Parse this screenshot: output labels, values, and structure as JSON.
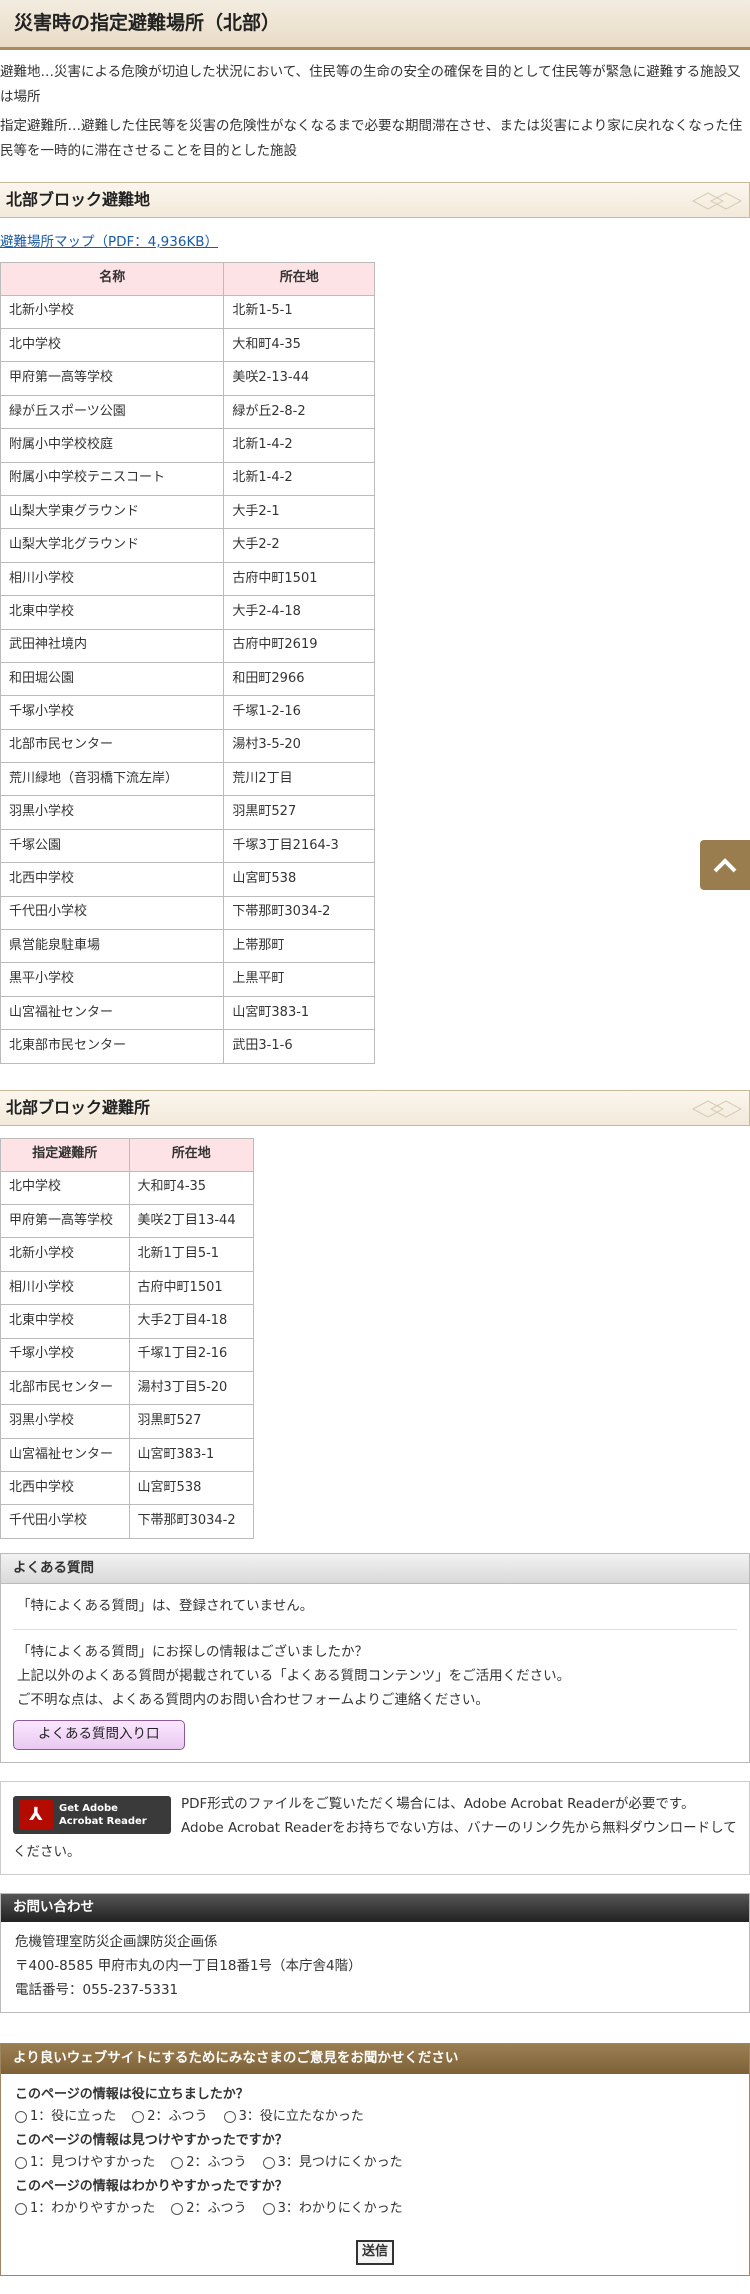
{
  "page": {
    "title": "災害時の指定避難場所（北部）",
    "definitions": [
      "避難地…災害による危険が切迫した状況において、住民等の生命の安全の確保を目的として住民等が緊急に避難する施設又は場所",
      "指定避難所…避難した住民等を災害の危険性がなくなるまで必要な期間滞在させ、または災害により家に戻れなくなった住民等を一時的に滞在させることを目的とした施設"
    ]
  },
  "section1": {
    "heading": "北部ブロック避難地",
    "pdf_link": "避難場所マップ（PDF：4,936KB）",
    "columns": [
      "名称",
      "所在地"
    ],
    "rows": [
      [
        "北新小学校",
        "北新1-5-1"
      ],
      [
        "北中学校",
        "大和町4-35"
      ],
      [
        "甲府第一高等学校",
        "美咲2-13-44"
      ],
      [
        "緑が丘スポーツ公園",
        "緑が丘2-8-2"
      ],
      [
        "附属小中学校校庭",
        "北新1-4-2"
      ],
      [
        "附属小中学校テニスコート",
        "北新1-4-2"
      ],
      [
        "山梨大学東グラウンド",
        "大手2-1"
      ],
      [
        "山梨大学北グラウンド",
        "大手2-2"
      ],
      [
        "相川小学校",
        "古府中町1501"
      ],
      [
        "北東中学校",
        "大手2-4-18"
      ],
      [
        "武田神社境内",
        "古府中町2619"
      ],
      [
        "和田堀公園",
        "和田町2966"
      ],
      [
        "千塚小学校",
        "千塚1-2-16"
      ],
      [
        "北部市民センター",
        "湯村3-5-20"
      ],
      [
        "荒川緑地（音羽橋下流左岸）",
        "荒川2丁目"
      ],
      [
        "羽黒小学校",
        "羽黒町527"
      ],
      [
        "千塚公園",
        "千塚3丁目2164-3"
      ],
      [
        "北西中学校",
        "山宮町538"
      ],
      [
        "千代田小学校",
        "下帯那町3034-2"
      ],
      [
        "県営能泉駐車場",
        "上帯那町"
      ],
      [
        "黒平小学校",
        "上黒平町"
      ],
      [
        "山宮福祉センター",
        "山宮町383-1"
      ],
      [
        "北東部市民センター",
        "武田3-1-6"
      ]
    ]
  },
  "section2": {
    "heading": "北部ブロック避難所",
    "columns": [
      "指定避難所",
      "所在地"
    ],
    "rows": [
      [
        "北中学校",
        "大和町4-35"
      ],
      [
        "甲府第一高等学校",
        "美咲2丁目13-44"
      ],
      [
        "北新小学校",
        "北新1丁目5-1"
      ],
      [
        "相川小学校",
        "古府中町1501"
      ],
      [
        "北東中学校",
        "大手2丁目4-18"
      ],
      [
        "千塚小学校",
        "千塚1丁目2-16"
      ],
      [
        "北部市民センター",
        "湯村3丁目5-20"
      ],
      [
        "羽黒小学校",
        "羽黒町527"
      ],
      [
        "山宮福祉センター",
        "山宮町383-1"
      ],
      [
        "北西中学校",
        "山宮町538"
      ],
      [
        "千代田小学校",
        "下帯那町3034-2"
      ]
    ]
  },
  "faq": {
    "heading": "よくある質問",
    "none_text": "「特によくある質問」は、登録されていません。",
    "more_lines": [
      "「特によくある質問」にお探しの情報はございましたか？",
      "上記以外のよくある質問が掲載されている「よくある質問コンテンツ」をご活用ください。",
      "ご不明な点は、よくある質問内のお問い合わせフォームよりご連絡ください。"
    ],
    "button": "よくある質問入り口"
  },
  "adobe": {
    "badge_line1": "Get Adobe",
    "badge_line2": "Acrobat Reader",
    "text": "PDF形式のファイルをご覧いただく場合には、Adobe Acrobat Readerが必要です。Adobe Acrobat Readerをお持ちでない方は、バナーのリンク先から無料ダウンロードしてください。"
  },
  "contact": {
    "heading": "お問い合わせ",
    "dept": "危機管理室防災企画課防災企画係",
    "address": "〒400-8585 甲府市丸の内一丁目18番1号（本庁舎4階）",
    "phone": "電話番号：055-237-5331"
  },
  "survey": {
    "heading": "より良いウェブサイトにするためにみなさまのご意見をお聞かせください",
    "questions": [
      {
        "q": "このページの情報は役に立ちましたか？",
        "opts": [
          "1：役に立った",
          "2：ふつう",
          "3：役に立たなかった"
        ]
      },
      {
        "q": "このページの情報は見つけやすかったですか？",
        "opts": [
          "1：見つけやすかった",
          "2：ふつう",
          "3：見つけにくかった"
        ]
      },
      {
        "q": "このページの情報はわかりやすかったですか？",
        "opts": [
          "1：わかりやすかった",
          "2：ふつう",
          "3：わかりにくかった"
        ]
      }
    ],
    "submit": "送信"
  },
  "icons": {
    "to_top": "chevron-up-icon",
    "adobe": "adobe-pdf-icon"
  },
  "colors": {
    "table_header_bg": "#fde3e6",
    "link": "#1a5aa6",
    "brown_accent": "#9a7d4f"
  }
}
